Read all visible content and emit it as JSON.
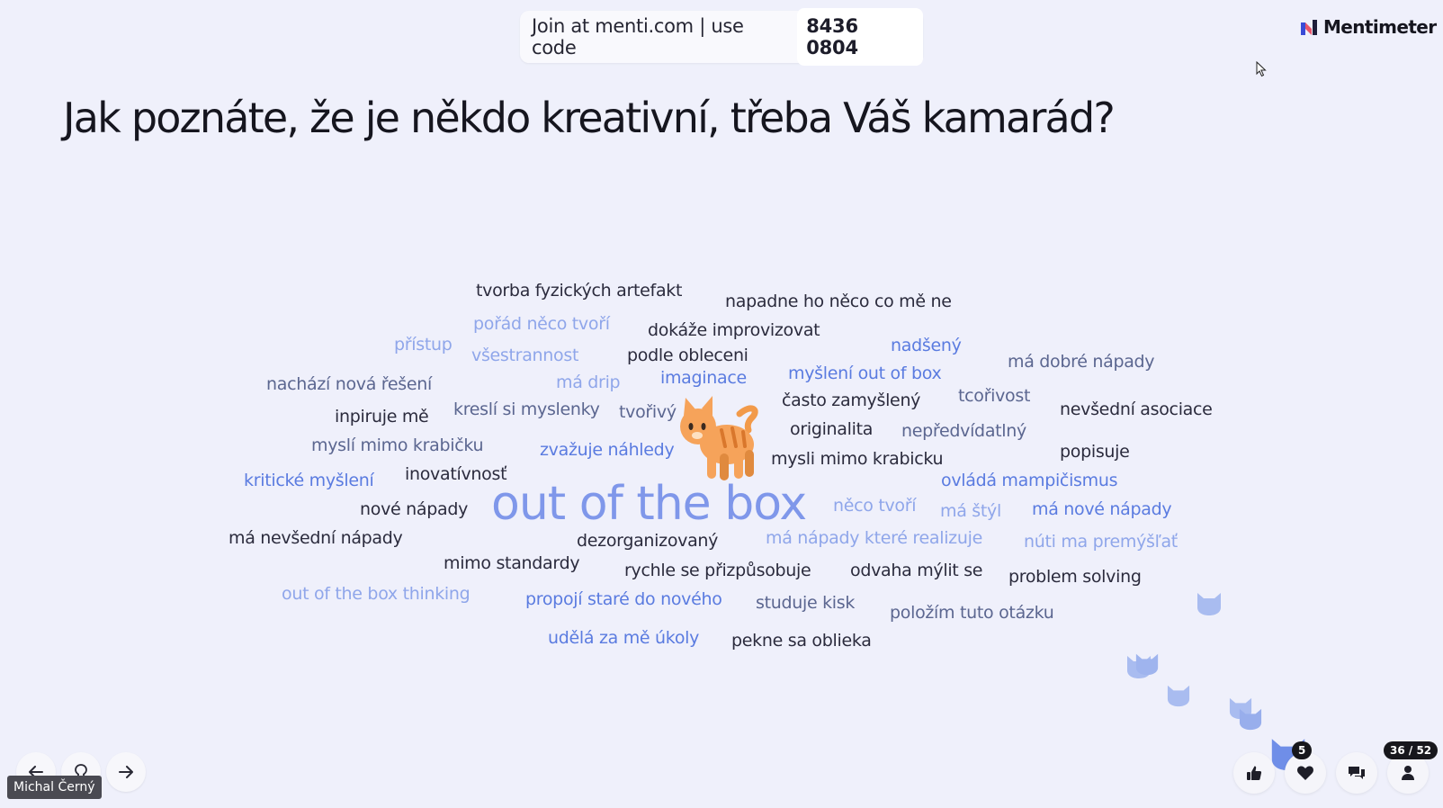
{
  "header": {
    "join_prefix": "Join at menti.com | use code",
    "join_code": "8436 0804",
    "brand_name": "Mentimeter"
  },
  "question": {
    "title": "Jak poznáte, že je někdo kreativní, třeba Váš kamarád?"
  },
  "word_cloud": [
    {
      "text": "tvorba fyzických artefakt",
      "color": "#2b2b3d"
    },
    {
      "text": "napadne ho něco co mě ne",
      "color": "#2b2b3d"
    },
    {
      "text": "pořád něco tvoří",
      "color": "#8fa6ea"
    },
    {
      "text": "dokáže improvizovat",
      "color": "#2b2b3d"
    },
    {
      "text": "přístup",
      "color": "#8fa6ea"
    },
    {
      "text": "všestrannost",
      "color": "#8fa6ea"
    },
    {
      "text": "podle obleceni",
      "color": "#2b2b3d"
    },
    {
      "text": "nadšený",
      "color": "#5a7be0"
    },
    {
      "text": "má dobré nápady",
      "color": "#5b6690"
    },
    {
      "text": "nachází nová řešení",
      "color": "#5b6690"
    },
    {
      "text": "má drip",
      "color": "#8fa6ea"
    },
    {
      "text": "imaginace",
      "color": "#5a7be0"
    },
    {
      "text": "myšlení out of box",
      "color": "#5a7be0"
    },
    {
      "text": "inpiruje mě",
      "color": "#2b2b3d"
    },
    {
      "text": "kreslí si myslenky",
      "color": "#5b6690"
    },
    {
      "text": "tvořivý",
      "color": "#5b6690"
    },
    {
      "text": "často zamyšlený",
      "color": "#2b2b3d"
    },
    {
      "text": "tcořivost",
      "color": "#5b6690"
    },
    {
      "text": "nevšední asociace",
      "color": "#2b2b3d"
    },
    {
      "text": "originalita",
      "color": "#2b2b3d"
    },
    {
      "text": "nepředvídatlný",
      "color": "#5b6690"
    },
    {
      "text": "myslí mimo krabičku",
      "color": "#5b6690"
    },
    {
      "text": "zvažuje náhledy",
      "color": "#5a7be0"
    },
    {
      "text": "mysli mimo krabicku",
      "color": "#2b2b3d"
    },
    {
      "text": "popisuje",
      "color": "#2b2b3d"
    },
    {
      "text": "kritické myšlení",
      "color": "#5a7be0"
    },
    {
      "text": "inovatívnosť",
      "color": "#2b2b3d"
    },
    {
      "text": "ovládá mampičismus",
      "color": "#5a7be0"
    },
    {
      "text": "out of the box",
      "color": "#7f97ea"
    },
    {
      "text": "nové nápady",
      "color": "#2b2b3d"
    },
    {
      "text": "něco tvoří",
      "color": "#8fa6ea"
    },
    {
      "text": "má štýl",
      "color": "#8fa6ea"
    },
    {
      "text": "má nové nápady",
      "color": "#5a7be0"
    },
    {
      "text": "má nevšední nápady",
      "color": "#2b2b3d"
    },
    {
      "text": "dezorganizovaný",
      "color": "#2b2b3d"
    },
    {
      "text": "má nápady které realizuje",
      "color": "#8fa6ea"
    },
    {
      "text": "núti ma premýšľať",
      "color": "#8fa6ea"
    },
    {
      "text": "mimo standardy",
      "color": "#2b2b3d"
    },
    {
      "text": "rychle se přizpůsobuje",
      "color": "#2b2b3d"
    },
    {
      "text": "odvaha mýlit se",
      "color": "#2b2b3d"
    },
    {
      "text": "problem solving",
      "color": "#2b2b3d"
    },
    {
      "text": "out of the box thinking",
      "color": "#8fa6ea"
    },
    {
      "text": "propojí staré do nového",
      "color": "#5a7be0"
    },
    {
      "text": "studuje kisk",
      "color": "#5b6690"
    },
    {
      "text": "položím tuto otázku",
      "color": "#5b6690"
    },
    {
      "text": "udělá za mě úkoly",
      "color": "#5a7be0"
    },
    {
      "text": "pekne sa oblieka",
      "color": "#2b2b3d"
    }
  ],
  "presenter": {
    "name": "Michal Černý"
  },
  "controls": {
    "reaction_count": "5",
    "participants": "36 / 52",
    "icons": {
      "back": "arrow-left-icon",
      "hint": "lightbulb-icon",
      "next": "arrow-right-icon",
      "like": "thumbs-up-icon",
      "react": "heart-icon",
      "qa": "chat-icon",
      "audience": "person-icon"
    }
  },
  "colors": {
    "background": "#eff0fb",
    "text_dark": "#2b2b3d",
    "text_mid": "#5b6690",
    "accent_blue": "#5a7be0",
    "accent_light": "#8fa6ea",
    "reaction_cat": "#a9bcf0"
  }
}
